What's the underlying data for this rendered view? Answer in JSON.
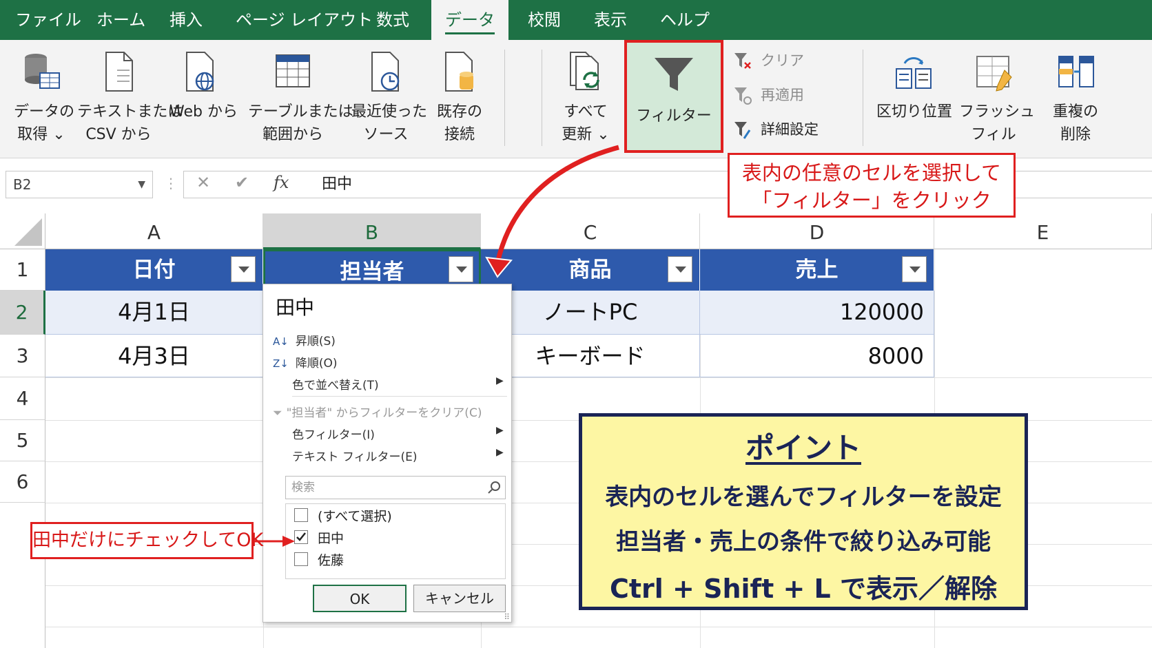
{
  "tabs": [
    "ファイル",
    "ホーム",
    "挿入",
    "ページ レイアウト",
    "数式",
    "データ",
    "校閲",
    "表示",
    "ヘルプ"
  ],
  "ribbon": {
    "get_data": [
      "データの",
      "取得 ⌄"
    ],
    "text_csv": [
      "テキストまたは",
      "CSV から"
    ],
    "web": [
      "Web から",
      ""
    ],
    "table_range": [
      "テーブルまたは",
      "範囲から"
    ],
    "recent": [
      "最近使った",
      "ソース"
    ],
    "existing": [
      "既存の",
      "接続"
    ],
    "refresh": [
      "すべて",
      "更新 ⌄"
    ],
    "filter": "フィルター",
    "clear": "クリア",
    "reapply": "再適用",
    "advanced": "詳細設定",
    "text_to_columns": [
      "区切り位置",
      ""
    ],
    "flash_fill": [
      "フラッシュ",
      "フィル"
    ],
    "remove_duplicates": [
      "重複の",
      "削除"
    ]
  },
  "formula_bar": {
    "name_box": "B2",
    "formula": "田中",
    "fx": "fx"
  },
  "columns": [
    "A",
    "B",
    "C",
    "D",
    "E"
  ],
  "rows": [
    "1",
    "2",
    "3",
    "4",
    "5",
    "6"
  ],
  "table": {
    "headers": [
      "日付",
      "担当者",
      "商品",
      "売上"
    ],
    "rows": [
      [
        "4月1日",
        "田中",
        "ノートPC",
        "120000"
      ],
      [
        "4月3日",
        "",
        "キーボード",
        "8000"
      ]
    ]
  },
  "filter_menu": {
    "value": "田中",
    "sort_asc": "昇順(S)",
    "sort_desc": "降順(O)",
    "sort_color": "色で並べ替え(T)",
    "clear": "\"担当者\" からフィルターをクリア(C)",
    "color_filter": "色フィルター(I)",
    "text_filter": "テキスト フィルター(E)",
    "search_placeholder": "検索",
    "items": [
      "(すべて選択)",
      "田中",
      "佐藤"
    ],
    "checked": [
      false,
      true,
      false
    ],
    "ok": "OK",
    "cancel": "キャンセル"
  },
  "callout_filter": [
    "表内の任意のセルを選択して",
    "「フィルター」をクリック"
  ],
  "callout_check": "田中だけにチェックしてOK",
  "point": {
    "title": "ポイント",
    "lines": [
      "表内のセルを選んでフィルターを設定",
      "担当者・売上の条件で絞り込み可能",
      "Ctrl + Shift + L で表示／解除"
    ]
  },
  "colors": {
    "excel_green": "#1e7145",
    "table_header": "#2e5aac",
    "callout_red": "#e02020",
    "point_bg": "#fdf6a3",
    "point_border": "#1a2456"
  }
}
